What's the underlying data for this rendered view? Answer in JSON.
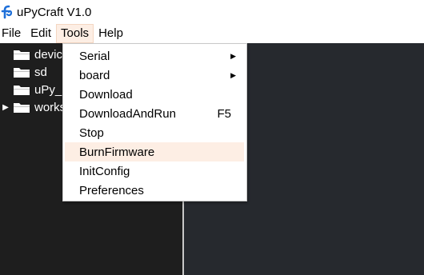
{
  "window": {
    "title": "uPyCraft V1.0"
  },
  "menubar": {
    "file": "File",
    "edit": "Edit",
    "tools": "Tools",
    "help": "Help"
  },
  "tree": {
    "items": [
      {
        "label": "device",
        "expanded": false
      },
      {
        "label": "sd",
        "expanded": false
      },
      {
        "label": "uPy_",
        "expanded": false
      },
      {
        "label": "works",
        "expanded": false
      }
    ]
  },
  "tools_menu": {
    "items": [
      {
        "label": "Serial",
        "submenu": true
      },
      {
        "label": "board",
        "submenu": true
      },
      {
        "label": "Download"
      },
      {
        "label": "DownloadAndRun",
        "shortcut": "F5"
      },
      {
        "label": "Stop"
      },
      {
        "label": "BurnFirmware",
        "highlighted": true
      },
      {
        "label": "InitConfig"
      },
      {
        "label": "Preferences"
      }
    ]
  },
  "colors": {
    "sidebar_bg": "#1e1e1e",
    "editor_bg": "#26292e",
    "menu_highlight": "#fdeee4",
    "app_icon": "#1e6fd9"
  }
}
